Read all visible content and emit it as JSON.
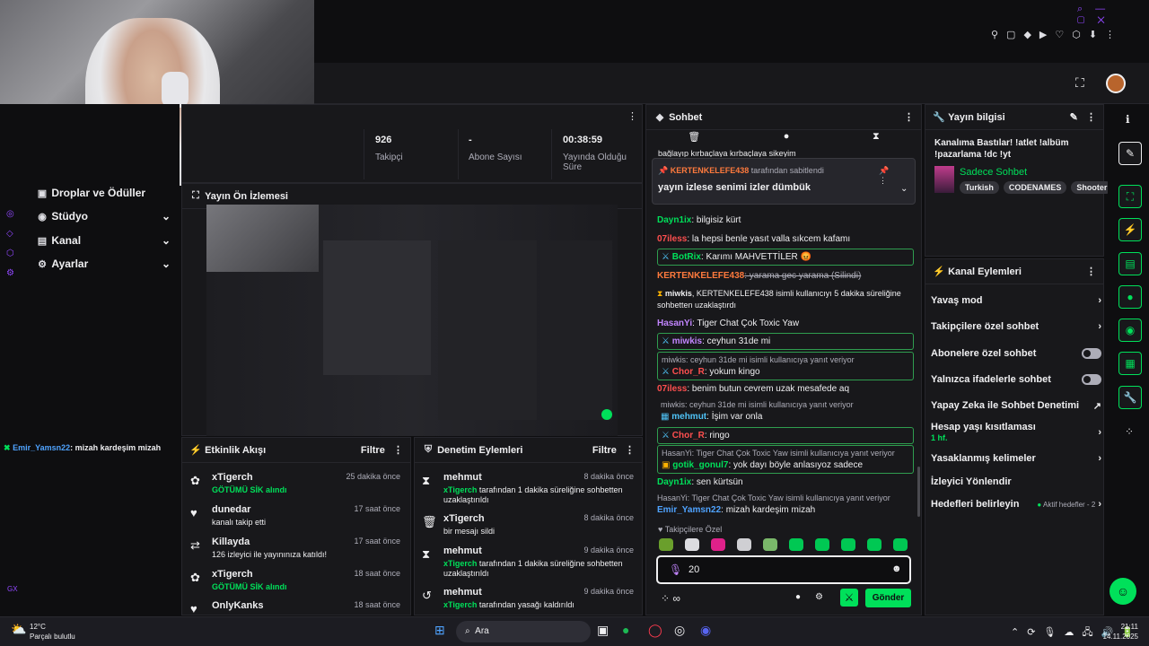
{
  "streamer_chat_overlay": {
    "user": "Emir_Yamsn22",
    "text": ": mizah kardeşim mizah"
  },
  "nav": {
    "items": [
      "Droplar ve Ödüller",
      "Stüdyo",
      "Kanal",
      "Ayarlar"
    ]
  },
  "stats": [
    {
      "value": "926",
      "label": "Takipçi"
    },
    {
      "value": "-",
      "label": "Abone Sayısı"
    },
    {
      "value": "00:38:59",
      "label": "Yayında Olduğu Süre"
    }
  ],
  "preview": {
    "title": "Yayın Ön İzlemesi"
  },
  "activity": {
    "title": "Etkinlik Akışı",
    "filter": "Filtre",
    "items": [
      {
        "icon": "gift-icon",
        "name": "xTigerch",
        "desc": "GÖTÜMÜ SİK alındı",
        "time": "25 dakika önce"
      },
      {
        "icon": "heart-icon",
        "name": "dunedar",
        "desc": "kanalı takip etti",
        "time": "17 saat önce"
      },
      {
        "icon": "raid-icon",
        "name": "Killayda",
        "desc": "126 izleyici ile yayınınıza katıldı!",
        "time": "17 saat önce"
      },
      {
        "icon": "gift-icon",
        "name": "xTigerch",
        "desc": "GÖTÜMÜ SİK alındı",
        "time": "18 saat önce"
      },
      {
        "icon": "heart-icon",
        "name": "OnlyKanks",
        "desc": "",
        "time": "18 saat önce"
      }
    ]
  },
  "moderation": {
    "title": "Denetim Eylemleri",
    "filter": "Filtre",
    "items": [
      {
        "icon": "hourglass-icon",
        "name": "mehmut",
        "desc_user": "xTigerch",
        "desc": " tarafından 1 dakika süreliğine sohbetten uzaklaştırıldı",
        "time": "8 dakika önce"
      },
      {
        "icon": "trash-icon",
        "name": "xTigerch",
        "desc_user": "",
        "desc": "bir mesajı sildi",
        "time": "8 dakika önce"
      },
      {
        "icon": "hourglass-icon",
        "name": "mehmut",
        "desc_user": "xTigerch",
        "desc": " tarafından 1 dakika süreliğine sohbetten uzaklaştırıldı",
        "time": "9 dakika önce"
      },
      {
        "icon": "undo-icon",
        "name": "mehmut",
        "desc_user": "xTigerch",
        "desc": " tarafından yasağı kaldırıldı",
        "time": "9 dakika önce"
      }
    ]
  },
  "chat": {
    "title": "Sohbet",
    "top_cut": "bağlayıp kırbaçlaya kırbaçlaya sikeyim",
    "pinned": {
      "by": "KERTENKELEFE438",
      "by_suffix": " tarafından sabitlendi",
      "text": "yayın izlese senimi izler dümbük"
    },
    "messages": [
      {
        "user": "Dayn1ix",
        "color": "#00e05a",
        "text": ": bilgisiz kürt"
      },
      {
        "user": "07iless",
        "color": "#ff4f4f",
        "text": ": la hepsi benle yasıt valla sıkcem kafamı"
      },
      {
        "user": "BotRix",
        "color": "#00e05a",
        "text": ": Karımı MAHVETTİLER 😡"
      },
      {
        "user": "KERTENKELEFE438",
        "color": "#ff7a3d",
        "text": ": yarama gec yarama (Silindi)"
      },
      {
        "user": "miwkis",
        "color": "#efeff1",
        "text": ", KERTENKELEFE438 isimli kullanıcıyı 5 dakika süreliğine sohbetten uzaklaştırdı"
      },
      {
        "user": "HasanYi",
        "color": "#c084fc",
        "text": ": Tiger Chat Çok Toxic Yaw"
      },
      {
        "user": "miwkis",
        "color": "#c084fc",
        "text": ": ceyhun 31de mi"
      },
      {
        "reply": "miwkis: ceyhun 31de mi isimli kullanıcıya yanıt veriyor",
        "user": "Chor_R",
        "color": "#ff4f4f",
        "text": ": yokum kingo"
      },
      {
        "user": "07iless",
        "color": "#ff4f4f",
        "text": ": benim butun cevrem uzak mesafede aq"
      },
      {
        "reply": "miwkis: ceyhun 31de mi isimli kullanıcıya yanıt veriyor",
        "user": "mehmut",
        "color": "#4fc3f7",
        "text": ": İşim var onla"
      },
      {
        "user": "Chor_R",
        "color": "#ff4f4f",
        "text": ": ringo"
      },
      {
        "reply": "HasanYi: Tiger Chat Çok Toxic Yaw isimli kullanıcıya yanıt veriyor",
        "user": "gotik_gonul7",
        "color": "#00e05a",
        "text": ": yok dayı böyle anlasıyoz sadece"
      },
      {
        "user": "Dayn1ix",
        "color": "#00e05a",
        "text": ": sen kürtsün"
      },
      {
        "reply": "HasanYi: Tiger Chat Çok Toxic Yaw isimli kullanıcıya yanıt veriyor",
        "user": "Emir_Yamsn22",
        "color": "#4fa3ff",
        "text": ": mizah kardeşim mizah"
      }
    ],
    "emote_header": "Takipçilere Özel",
    "input_value": "20",
    "send": "Gönder"
  },
  "info": {
    "title": "Yayın bilgisi",
    "stream_title": "Kanalıma Bastılar! !atlet !albüm !pazarlama !dc !yt",
    "category": "Sadece Sohbet",
    "tags": [
      "Turkish",
      "CODENAMES",
      "Shooter"
    ]
  },
  "actions": {
    "title": "Kanal Eylemleri",
    "items": [
      {
        "label": "Yavaş mod",
        "ctrl": "chevron"
      },
      {
        "label": "Takipçilere özel sohbet",
        "ctrl": "chevron"
      },
      {
        "label": "Abonelere özel sohbet",
        "ctrl": "toggle"
      },
      {
        "label": "Yalnızca ifadelerle sohbet",
        "ctrl": "toggle"
      },
      {
        "label": "Yapay Zeka ile Sohbet Denetimi",
        "ctrl": "external"
      },
      {
        "label": "Hesap yaşı kısıtlaması",
        "sub": "1 hf.",
        "ctrl": "chevron"
      },
      {
        "label": "Yasaklanmış kelimeler",
        "ctrl": "chevron"
      },
      {
        "label": "İzleyici Yönlendir",
        "ctrl": ""
      },
      {
        "label": "Hedefleri belirleyin",
        "extra": "Aktif hedefler - 2",
        "ctrl": "chevron"
      }
    ]
  },
  "taskbar": {
    "temp": "12°C",
    "weather": "Parçalı bulutlu",
    "search": "Ara",
    "time": "21:11",
    "date": "14.11.2025"
  },
  "misc": {
    "gx": "GX"
  }
}
